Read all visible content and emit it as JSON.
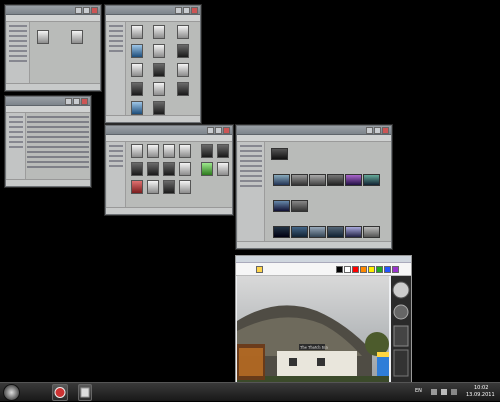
{
  "taskbar": {
    "language": "EN",
    "time": "10:02",
    "date": "13.09.2011"
  },
  "windows": [
    {
      "id": "explorer-1",
      "kind": "explorer"
    },
    {
      "id": "explorer-2",
      "kind": "explorer"
    },
    {
      "id": "explorer-3",
      "kind": "explorer"
    },
    {
      "id": "explorer-4",
      "kind": "explorer"
    },
    {
      "id": "explorer-5",
      "kind": "explorer"
    },
    {
      "id": "paint-photo",
      "kind": "image-editor"
    }
  ],
  "photo_sign": "The Thatch Inn",
  "colors": {
    "desktop": "#000000",
    "window_chrome": "#b9bbb9",
    "taskbar": "#1f1f1f",
    "palette_swatches": [
      "#000000",
      "#ffffff",
      "#ff0000",
      "#ff8800",
      "#ffee00",
      "#22aa22",
      "#2255ff",
      "#9933cc"
    ]
  },
  "icons": {
    "start": "windows-orb-icon",
    "taskbar_app_1": "media-player-icon",
    "taskbar_app_2": "explorer-icon",
    "tray": [
      "network-icon",
      "volume-icon",
      "flag-icon"
    ]
  }
}
